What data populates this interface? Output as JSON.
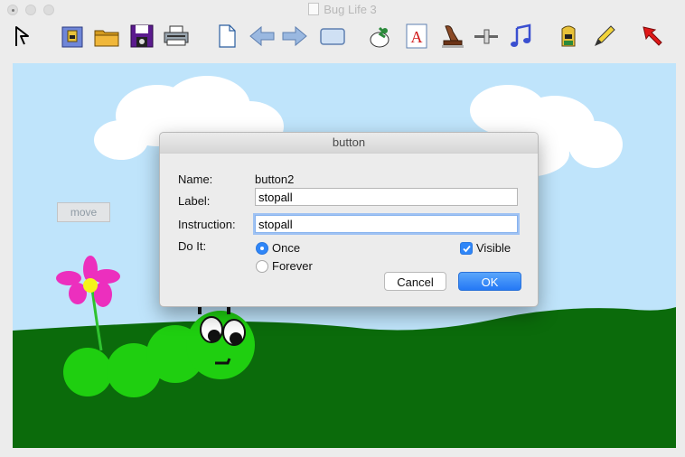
{
  "window": {
    "title": "Bug Life 3"
  },
  "toolbar": {
    "tools": [
      {
        "name": "pointer-tool-icon"
      },
      {
        "name": "backpack-open-icon"
      },
      {
        "name": "folder-icon"
      },
      {
        "name": "floppy-disk-icon"
      },
      {
        "name": "printer-icon"
      },
      {
        "name": "new-page-icon"
      },
      {
        "name": "arrow-left-icon"
      },
      {
        "name": "arrow-right-icon"
      },
      {
        "name": "rectangle-button-icon"
      },
      {
        "name": "turtle-hatch-icon"
      },
      {
        "name": "text-tool-icon"
      },
      {
        "name": "stamp-icon"
      },
      {
        "name": "slider-icon"
      },
      {
        "name": "music-note-icon"
      },
      {
        "name": "backpack-icon"
      },
      {
        "name": "pencil-icon"
      },
      {
        "name": "red-arrow-icon"
      }
    ]
  },
  "canvas": {
    "move_button": "move"
  },
  "dialog": {
    "title": "button",
    "name_label": "Name:",
    "name_value": "button2",
    "label_label": "Label:",
    "label_value": "stopall",
    "instruction_label": "Instruction:",
    "instruction_value": "stopall",
    "doit_label": "Do It:",
    "once_label": "Once",
    "forever_label": "Forever",
    "once_selected": true,
    "visible_label": "Visible",
    "visible_checked": true,
    "cancel_label": "Cancel",
    "ok_label": "OK"
  }
}
